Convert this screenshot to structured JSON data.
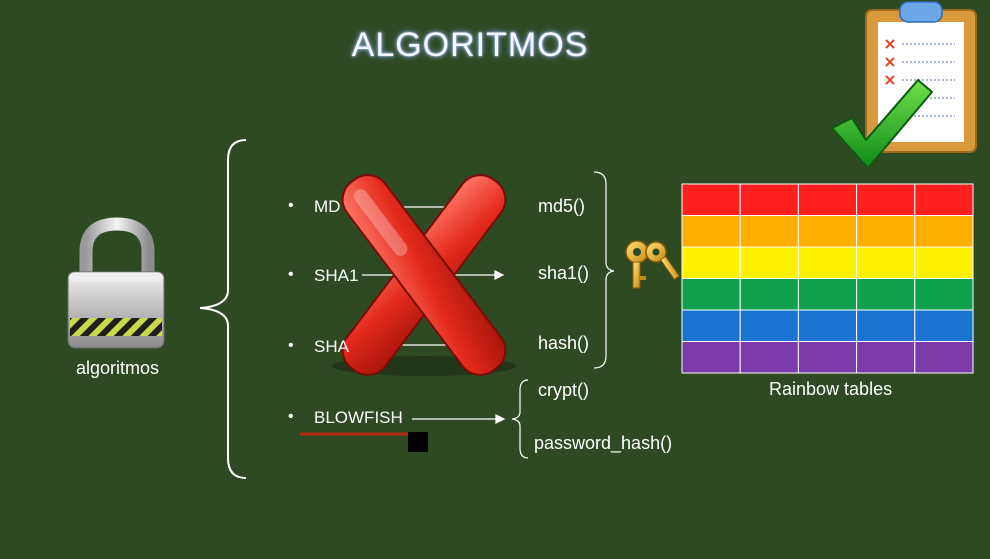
{
  "slide": {
    "title": "ALGORITMOS",
    "lock_label": "algoritmos",
    "items": [
      {
        "label": "MD5",
        "visible_text": "MD"
      },
      {
        "label": "SHA1",
        "visible_text": "SHA1"
      },
      {
        "label": "SHA",
        "visible_text": "SHA"
      },
      {
        "label": "BLOWFISH",
        "visible_text": "BLOWFISH"
      }
    ],
    "functions": [
      "md5()",
      "sha1()",
      "hash()",
      "crypt()",
      "password_hash()"
    ],
    "rainbow_caption": "Rainbow tables",
    "rainbow_colors": [
      "#ff1f1f",
      "#ffae00",
      "#fff200",
      "#0ea04a",
      "#1a73d0",
      "#7a3aa8"
    ],
    "accent_underline": "#b02a12",
    "icons": [
      "padlock-icon",
      "red-x-icon",
      "keys-icon",
      "clipboard-icon",
      "green-check-icon"
    ]
  }
}
